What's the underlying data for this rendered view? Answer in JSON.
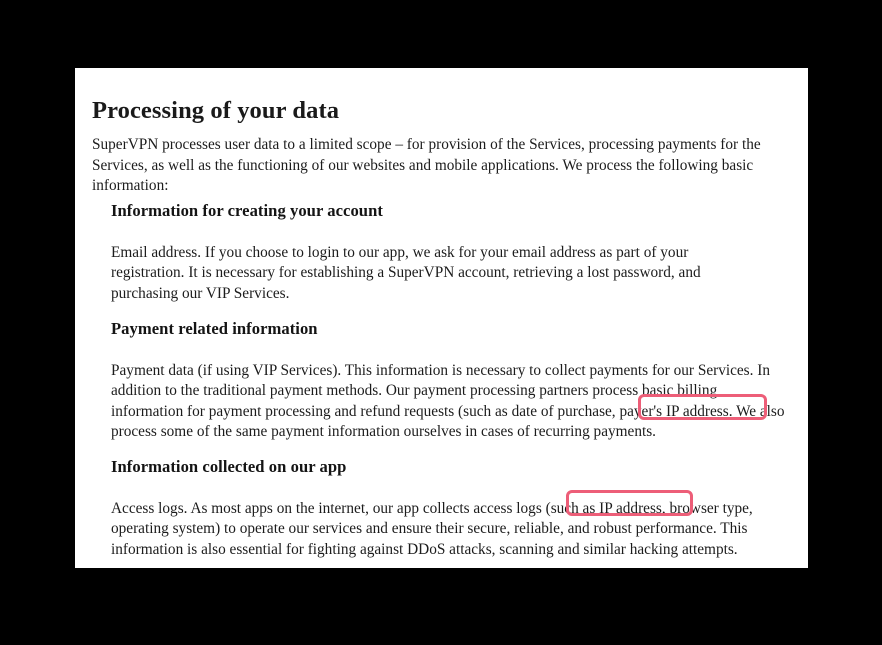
{
  "document": {
    "title": "Processing of your data",
    "intro": "SuperVPN processes user data to a limited scope – for provision of the Services, processing payments for the Services, as well as the functioning of our websites and mobile applications. We process the following basic information:",
    "sections": [
      {
        "heading": "Information for creating your account",
        "body": "Email address. If you choose to login to our app, we ask for your email address as part of your registration. It is necessary for establishing a SuperVPN account, retrieving a lost password, and purchasing our VIP Services."
      },
      {
        "heading": "Payment related information",
        "body": "Payment data (if using VIP Services). This information is necessary to collect payments for our Services. In addition to the traditional payment methods. Our payment processing partners process basic billing information for payment processing and refund requests (such as date of purchase, payer's IP address. We also process some of the same payment information ourselves in cases of recurring payments."
      },
      {
        "heading": "Information collected on our app",
        "body": "Access logs. As most apps on the internet, our app collects access logs (such as IP address, browser type, operating system) to operate our services and ensure their secure, reliable, and robust performance. This information is also essential for fighting against DDoS attacks, scanning and similar hacking attempts."
      }
    ]
  },
  "annotations": {
    "highlight_color": "#ed5e78",
    "boxes": [
      {
        "label": "payer's IP address.",
        "section": "Payment related information"
      },
      {
        "label": "(such as IP address,",
        "section": "Information collected on our app"
      }
    ]
  },
  "colors": {
    "background": "#000000",
    "page": "#ffffff",
    "text": "#1c1c1c",
    "heading": "#141414",
    "accent": "#ed5e78"
  }
}
